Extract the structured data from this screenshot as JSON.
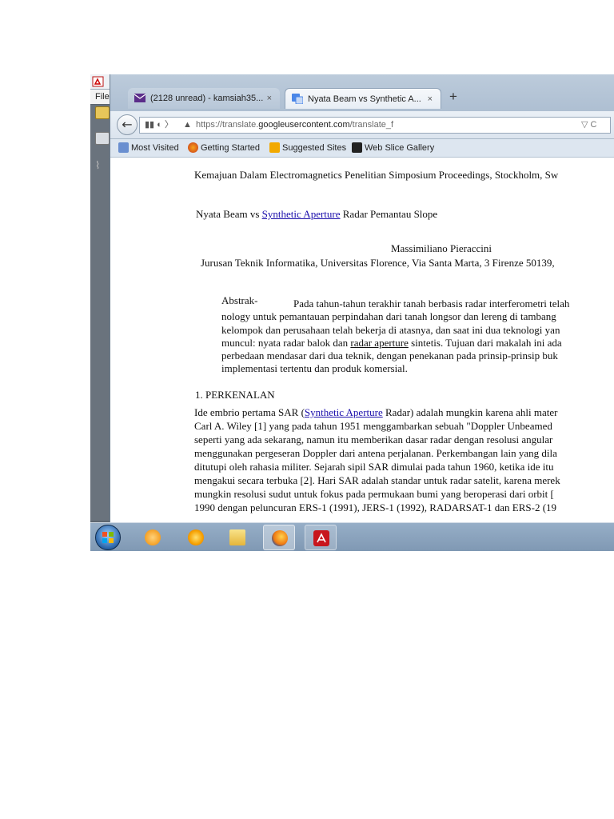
{
  "acrobat": {
    "menu_label": "File"
  },
  "tabs": [
    {
      "label": "(2128 unread) - kamsiah35...",
      "close": "×",
      "active": false
    },
    {
      "label": "Nyata Beam vs Synthetic A...",
      "close": "×",
      "active": true
    }
  ],
  "newtab_label": "+",
  "navbar": {
    "back_glyph": "←",
    "url_prefix": "https://translate.",
    "url_domain": "googleusercontent.com",
    "url_path": "/translate_f",
    "right_controls": "▽ C"
  },
  "bookmarks": [
    "Most Visited",
    "Getting Started",
    "Suggested Sites",
    "Web Slice Gallery"
  ],
  "article": {
    "header_line": "Kemajuan Dalam Electromagnetics Penelitian Simposium Proceedings, Stockholm, Sw",
    "title_pre": "Nyata Beam vs ",
    "title_link": "Synthetic Aperture",
    "title_post": " Radar Pemantau Slope",
    "author": "Massimiliano Pieraccini",
    "affiliation": "Jurusan Teknik Informatika, Universitas Florence, Via Santa Marta, 3 Firenze 50139,",
    "abstract_label": "Abstrak-",
    "abstract_first": "Pada tahun-tahun terakhir tanah berbasis radar interferometri telah",
    "abstract_lines": [
      "nology untuk pemantauan perpindahan dari tanah longsor dan lereng di tambang",
      "kelompok dan perusahaan telah bekerja di atasnya, dan saat ini dua teknologi yan",
      "perbedaan mendasar dari dua teknik, dengan penekanan pada prinsip-prinsip buk",
      "implementasi tertentu dan produk komersial."
    ],
    "abstract_l4_pre": "muncul: nyata radar balok dan ",
    "abstract_l4_link": "radar aperture",
    "abstract_l4_post": " sintetis. Tujuan dari makalah ini ada",
    "section_heading": "1. PERKENALAN",
    "body_l1_pre": "Ide embrio pertama SAR (",
    "body_l1_link": "Synthetic Aperture",
    "body_l1_post": " Radar) adalah mungkin karena ahli mater",
    "body_lines": [
      "Carl A. Wiley [1] yang pada tahun 1951 menggambarkan sebuah \"Doppler Unbeamed",
      "seperti yang ada sekarang, namun itu memberikan dasar radar dengan resolusi angular",
      "menggunakan pergeseran Doppler dari antena perjalanan. Perkembangan lain yang dila",
      "ditutupi oleh rahasia militer. Sejarah sipil SAR dimulai pada tahun 1960, ketika ide itu",
      "mengakui secara terbuka [2]. Hari SAR adalah standar untuk radar satelit, karena merek",
      "mungkin resolusi sudut untuk fokus pada permukaan bumi yang beroperasi dari orbit [",
      "1990 dengan peluncuran ERS-1 (1991), JERS-1 (1992), RADARSAT-1 dan ERS-2 (19"
    ]
  },
  "taskbar": [
    "start-button",
    "media-player",
    "chrome-like-app",
    "file-explorer",
    "firefox",
    "acrobat-reader"
  ],
  "colors": {
    "link": "#1a0dab",
    "tabstrip": "#b4c4d6",
    "taskbar": "#8aa3be"
  }
}
